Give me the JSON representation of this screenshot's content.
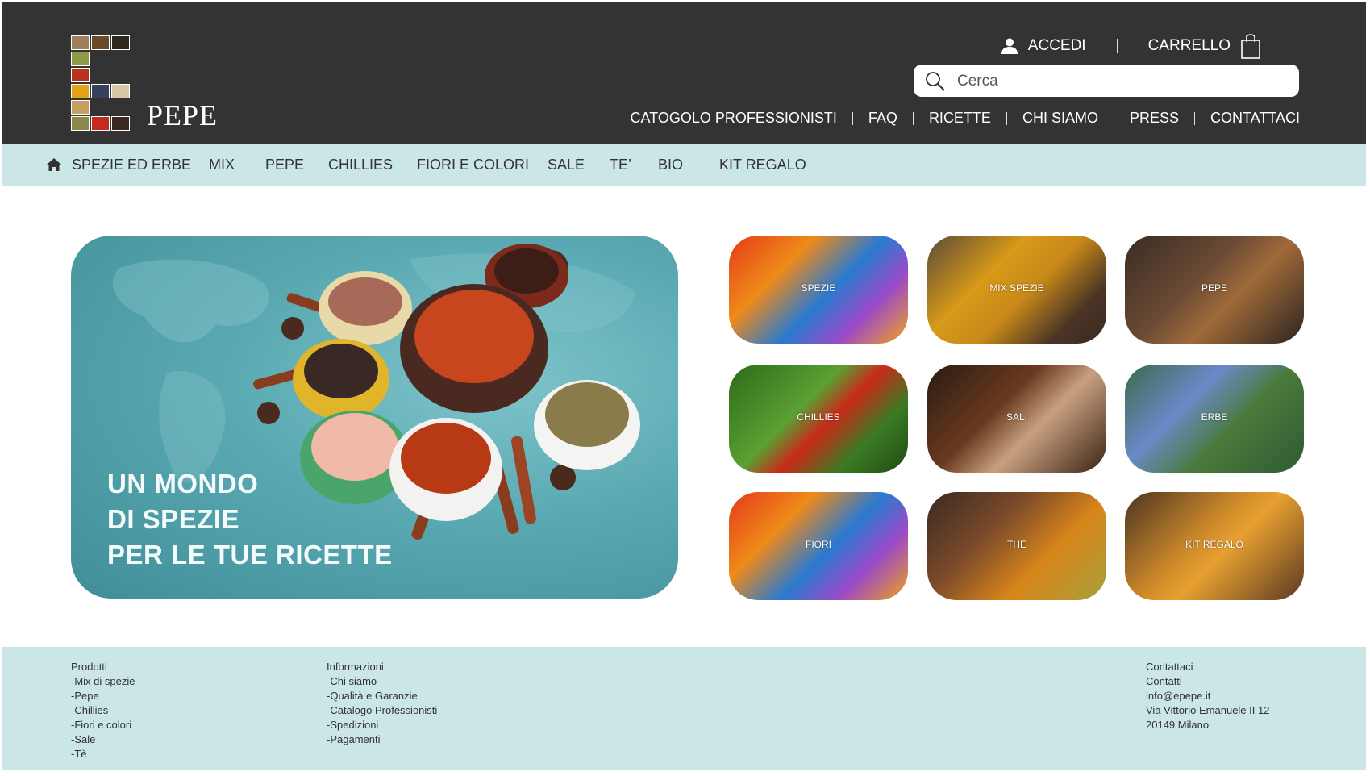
{
  "brand": {
    "name": "PEPE"
  },
  "account": {
    "login_label": "ACCEDI",
    "cart_label": "CARRELLO"
  },
  "search": {
    "placeholder": "Cerca"
  },
  "top_nav": [
    "CATOGOLO PROFESSIONISTI",
    "FAQ",
    "RICETTE",
    "CHI SIAMO",
    "PRESS",
    "CONTATTACI"
  ],
  "categories": [
    "SPEZIE ED ERBE",
    "MIX",
    "PEPE",
    "CHILLIES",
    "FIORI E COLORI",
    "SALE",
    "TE’",
    "BIO",
    "KIT REGALO"
  ],
  "hero": {
    "lines": [
      "UN MONDO",
      "DI SPEZIE",
      "PER LE TUE RICETTE"
    ]
  },
  "tiles": [
    "SPEZIE",
    "MIX SPEZIE",
    "PEPE",
    "CHILLIES",
    "SALI",
    "ERBE",
    "FIORI",
    "THE",
    "KIT REGALO"
  ],
  "footer": {
    "products": {
      "title": "Prodotti",
      "items": [
        "-Mix di spezie",
        "-Pepe",
        "-Chillies",
        "-Fiori e colori",
        "-Sale",
        "-Tè"
      ]
    },
    "info": {
      "title": "Informazioni",
      "items": [
        "-Chi siamo",
        "-Qualità e Garanzie",
        "-Catalogo Professionisti",
        "-Spedizioni",
        "-Pagamenti"
      ]
    },
    "contacts": {
      "title": "Contattaci",
      "items": [
        "Contatti",
        "info@epepe.it",
        "Via Vittorio Emanuele II 12",
        "20149 Milano"
      ]
    }
  },
  "colors": {
    "header": "#333333",
    "accent_bar": "#cbe6e6",
    "footer": "#cbe6e6"
  }
}
